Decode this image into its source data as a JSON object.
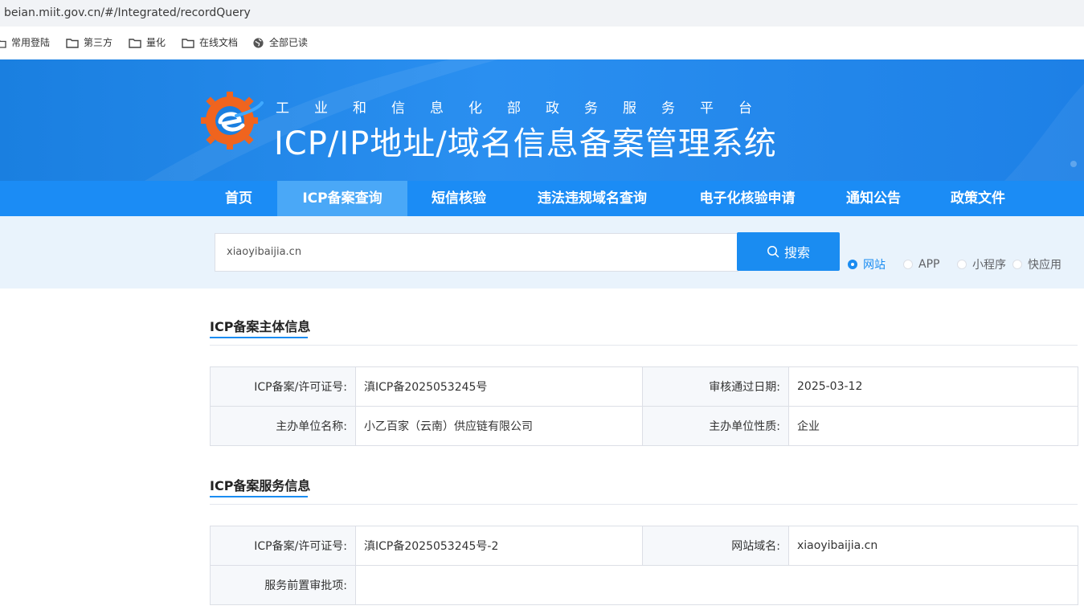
{
  "browser": {
    "url": "beian.miit.gov.cn/#/Integrated/recordQuery",
    "bookmarks": [
      "常用登陆",
      "第三方",
      "量化",
      "在线文档",
      "全部已读"
    ]
  },
  "header": {
    "subtitle": "工业和信息化部政务服务平台",
    "title": "ICP/IP地址/域名信息备案管理系统"
  },
  "nav": {
    "items": [
      "首页",
      "ICP备案查询",
      "短信核验",
      "违法违规域名查询",
      "电子化核验申请",
      "通知公告",
      "政策文件"
    ],
    "active_index": 1
  },
  "search": {
    "value": "xiaoyibaijia.cn",
    "button_label": "搜索",
    "types": [
      "网站",
      "APP",
      "小程序",
      "快应用"
    ],
    "selected_type": "网站"
  },
  "subject_section": {
    "title": "ICP备案主体信息",
    "rows": [
      {
        "k1": "ICP备案/许可证号:",
        "v1": "滇ICP备2025053245号",
        "k2": "审核通过日期:",
        "v2": "2025-03-12"
      },
      {
        "k1": "主办单位名称:",
        "v1": "小乙百家（云南）供应链有限公司",
        "k2": "主办单位性质:",
        "v2": "企业"
      }
    ]
  },
  "service_section": {
    "title": "ICP备案服务信息",
    "row1": {
      "k1": "ICP备案/许可证号:",
      "v1": "滇ICP备2025053245号-2",
      "k2": "网站域名:",
      "v2": "xiaoyibaijia.cn"
    },
    "row2": {
      "k1": "服务前置审批项:",
      "v1": ""
    }
  },
  "colors": {
    "primary": "#1a8cf1",
    "nav_bg": "#1b8cf5",
    "nav_active": "#4aa8f7",
    "search_bg": "#e9f3fc",
    "logo_orange": "#f0641e"
  }
}
